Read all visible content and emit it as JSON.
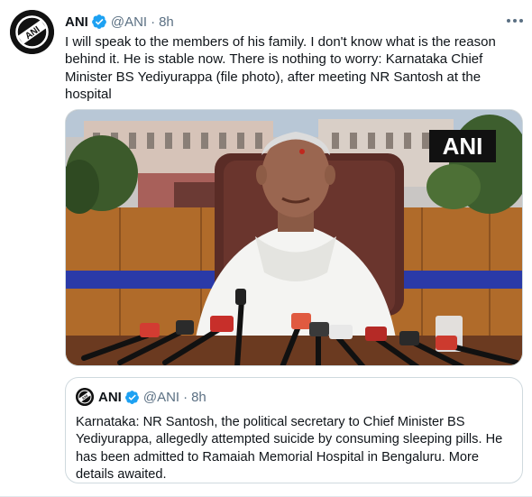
{
  "tweet": {
    "author_name": "ANI",
    "author_handle": "@ANI",
    "separator": "·",
    "time": "8h",
    "text": "I will speak to the members of his family. I don't know what is the reason behind it. He is stable now. There is nothing to worry: Karnataka Chief Minister BS Yediyurappa (file photo), after meeting NR Santosh at the hospital",
    "avatar_text": "ANI",
    "media": {
      "watermark": "ANI"
    }
  },
  "quoted_tweet": {
    "author_name": "ANI",
    "author_handle": "@ANI",
    "separator": "·",
    "time": "8h",
    "text": "Karnataka: NR Santosh, the political secretary to Chief Minister BS Yediyurappa, allegedly attempted suicide by consuming sleeping pills. He has been admitted to Ramaiah Memorial Hospital in Bengaluru. More details awaited.",
    "avatar_text": "ANI"
  },
  "icons": {
    "verified": "verified-badge-icon",
    "more": "more-horizontal-icon"
  },
  "colors": {
    "verified_blue": "#1da1f2",
    "secondary_text": "#5b7083",
    "border": "#cfd9de"
  }
}
